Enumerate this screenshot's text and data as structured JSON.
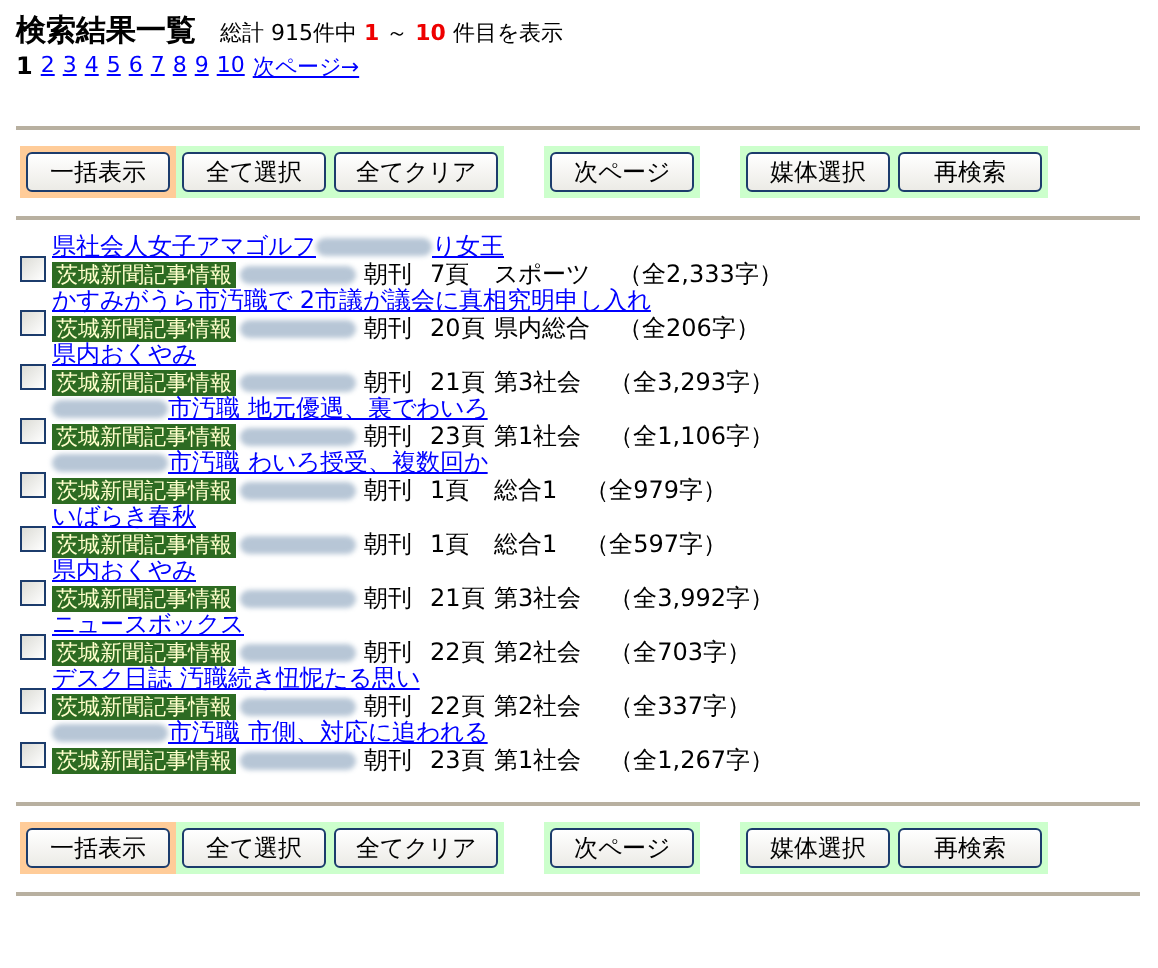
{
  "header": {
    "title": "検索結果一覧",
    "summary": {
      "prefix": "総計 915件中",
      "from": "1",
      "sep": "～",
      "to": "10",
      "suffix": "件目を表示"
    }
  },
  "pager": {
    "pages": [
      {
        "label": "1",
        "selected": true
      },
      {
        "label": "2",
        "selected": false
      },
      {
        "label": "3",
        "selected": false
      },
      {
        "label": "4",
        "selected": false
      },
      {
        "label": "5",
        "selected": false
      },
      {
        "label": "6",
        "selected": false
      },
      {
        "label": "7",
        "selected": false
      },
      {
        "label": "8",
        "selected": false
      },
      {
        "label": "9",
        "selected": false
      },
      {
        "label": "10",
        "selected": false
      }
    ],
    "next": "次ページ→"
  },
  "top_toolbar": [
    {
      "color": "#ffcc99",
      "buttons": [
        "一括表示"
      ]
    },
    {
      "color": "#ccffcc",
      "buttons": [
        "全て選択",
        "全てクリア"
      ]
    },
    {
      "color": "#ccffcc",
      "buttons": [
        "次ページ"
      ]
    },
    {
      "color": "#ccffcc",
      "buttons": [
        "媒体選択",
        "再検索"
      ]
    }
  ],
  "results": [
    {
      "checked": false,
      "title": [
        {
          "kind": "text",
          "text": "県社会人女子アマゴルフ"
        },
        {
          "kind": "blur"
        },
        {
          "kind": "text",
          "text": "り女王"
        }
      ],
      "source": "茨城新聞記事情報",
      "edition": "朝刊",
      "page": "7頁",
      "section": "スポーツ",
      "length": "（全2,333字）"
    },
    {
      "checked": false,
      "title": [
        {
          "kind": "text",
          "text": "かすみがうら市汚職で 2市議が議会に真相究明申し入れ"
        }
      ],
      "source": "茨城新聞記事情報",
      "edition": "朝刊",
      "page": "20頁",
      "section": "県内総合",
      "length": "（全206字）"
    },
    {
      "checked": false,
      "title": [
        {
          "kind": "text",
          "text": "県内おくやみ"
        }
      ],
      "source": "茨城新聞記事情報",
      "edition": "朝刊",
      "page": "21頁",
      "section": "第3社会",
      "length": "（全3,293字）"
    },
    {
      "checked": false,
      "title": [
        {
          "kind": "blur"
        },
        {
          "kind": "text",
          "text": "市汚職 地元優遇、裏でわいろ"
        }
      ],
      "source": "茨城新聞記事情報",
      "edition": "朝刊",
      "page": "23頁",
      "section": "第1社会",
      "length": "（全1,106字）"
    },
    {
      "checked": false,
      "title": [
        {
          "kind": "blur"
        },
        {
          "kind": "text",
          "text": "市汚職 わいろ授受、複数回か"
        }
      ],
      "source": "茨城新聞記事情報",
      "edition": "朝刊",
      "page": "1頁",
      "section": "総合1",
      "length": "（全979字）"
    },
    {
      "checked": false,
      "title": [
        {
          "kind": "text",
          "text": "いばらき春秋"
        }
      ],
      "source": "茨城新聞記事情報",
      "edition": "朝刊",
      "page": "1頁",
      "section": "総合1",
      "length": "（全597字）"
    },
    {
      "checked": false,
      "title": [
        {
          "kind": "text",
          "text": "県内おくやみ"
        }
      ],
      "source": "茨城新聞記事情報",
      "edition": "朝刊",
      "page": "21頁",
      "section": "第3社会",
      "length": "（全3,992字）"
    },
    {
      "checked": false,
      "title": [
        {
          "kind": "text",
          "text": "ニュースボックス"
        }
      ],
      "source": "茨城新聞記事情報",
      "edition": "朝刊",
      "page": "22頁",
      "section": "第2社会",
      "length": "（全703字）"
    },
    {
      "checked": false,
      "title": [
        {
          "kind": "text",
          "text": "デスク日誌 汚職続き忸怩たる思い"
        }
      ],
      "source": "茨城新聞記事情報",
      "edition": "朝刊",
      "page": "22頁",
      "section": "第2社会",
      "length": "（全337字）"
    },
    {
      "checked": false,
      "title": [
        {
          "kind": "blur"
        },
        {
          "kind": "text",
          "text": "市汚職 市側、対応に追われる"
        }
      ],
      "source": "茨城新聞記事情報",
      "edition": "朝刊",
      "page": "23頁",
      "section": "第1社会",
      "length": "（全1,267字）"
    }
  ],
  "bottom_toolbar": [
    {
      "color": "#ffcc99",
      "buttons": [
        "一括表示"
      ]
    },
    {
      "color": "#ccffcc",
      "buttons": [
        "全て選択",
        "全てクリア"
      ]
    },
    {
      "color": "#ccffcc",
      "buttons": [
        "次ページ"
      ]
    },
    {
      "color": "#ccffcc",
      "buttons": [
        "媒体選択",
        "再検索"
      ]
    }
  ]
}
